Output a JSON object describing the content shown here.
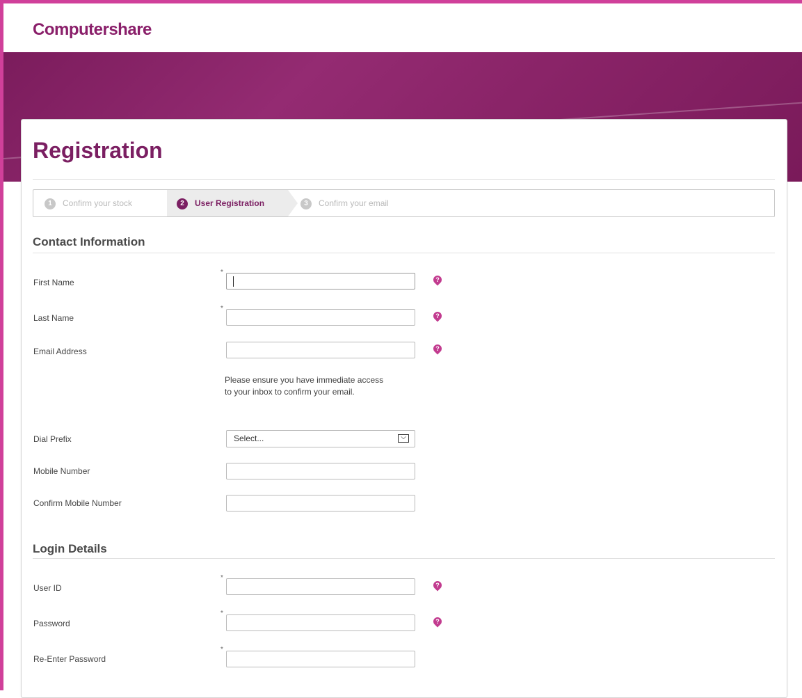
{
  "brand": {
    "name": "Computershare"
  },
  "page": {
    "title": "Registration"
  },
  "steps": [
    {
      "number": "1",
      "label": "Confirm your stock"
    },
    {
      "number": "2",
      "label": "User Registration"
    },
    {
      "number": "3",
      "label": "Confirm your email"
    }
  ],
  "contact": {
    "heading": "Contact Information",
    "first_name": {
      "label": "First Name",
      "required": "*"
    },
    "last_name": {
      "label": "Last Name",
      "required": "*"
    },
    "email": {
      "label": "Email Address"
    },
    "email_note": "Please ensure you have immediate access to your inbox to confirm your email.",
    "dial_prefix": {
      "label": "Dial Prefix",
      "selected": "Select..."
    },
    "mobile": {
      "label": "Mobile Number"
    },
    "confirm_mobile": {
      "label": "Confirm Mobile Number"
    }
  },
  "login": {
    "heading": "Login Details",
    "user_id": {
      "label": "User ID",
      "required": "*"
    },
    "password": {
      "label": "Password",
      "required": "*"
    },
    "reenter_password": {
      "label": "Re-Enter Password",
      "required": "*"
    }
  },
  "help_icon": "?",
  "dropdown_icon": "⌵",
  "colors": {
    "brand": "#7b1f62",
    "accent_border": "#d0409a",
    "help": "#c23b8f"
  }
}
